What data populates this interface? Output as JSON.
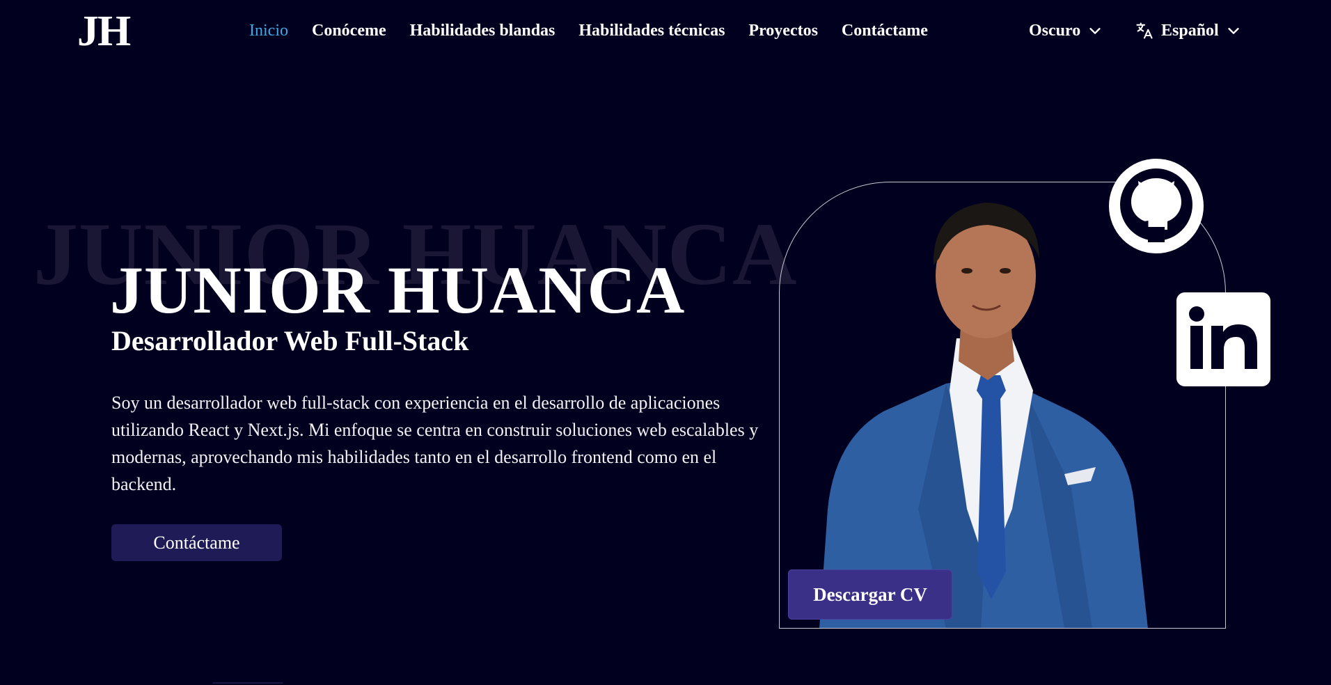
{
  "nav": {
    "logo": "JH",
    "links": [
      "Inicio",
      "Conóceme",
      "Habilidades blandas",
      "Habilidades técnicas",
      "Proyectos",
      "Contáctame"
    ],
    "active_index": 0,
    "theme_label": "Oscuro",
    "language_label": "Español"
  },
  "hero": {
    "watermark": "JUNIOR HUANCA",
    "name": "JUNIOR HUANCA",
    "role": "Desarrollador Web Full-Stack",
    "description": "Soy un desarrollador web full-stack con experiencia en el desarrollo de aplicaciones utilizando React y Next.js. Mi enfoque se centra en construir soluciones web escalables y modernas, aprovechando mis habilidades tanto en el desarrollo frontend como en el backend.",
    "contact_button": "Contáctame",
    "cv_button": "Descargar CV"
  },
  "social": {
    "github_icon": "github-icon",
    "linkedin_icon": "linkedin-icon"
  },
  "colors": {
    "background": "#02001f",
    "accent": "#3fa9e6",
    "contact_button": "#1e1b56",
    "cv_button": "#3a3088"
  }
}
